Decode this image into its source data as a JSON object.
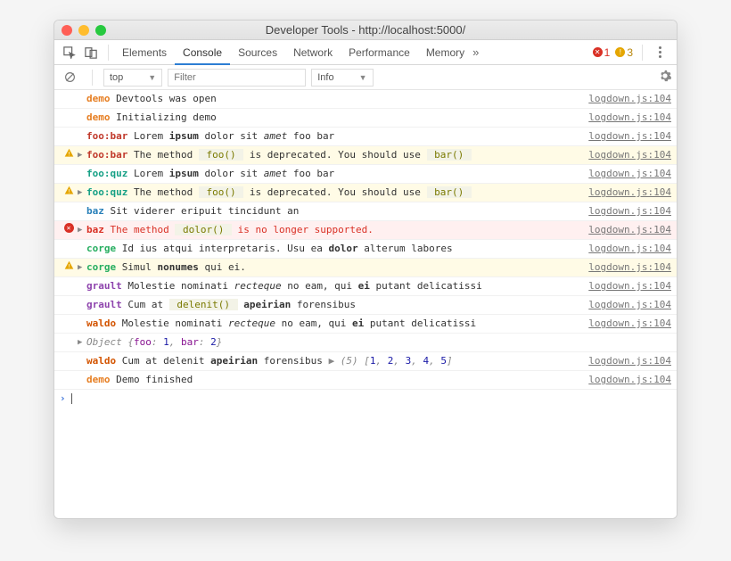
{
  "window_title": "Developer Tools - http://localhost:5000/",
  "tabs": [
    "Elements",
    "Console",
    "Sources",
    "Network",
    "Performance",
    "Memory"
  ],
  "active_tab": "Console",
  "error_count": "1",
  "warning_count": "3",
  "context_select": "top",
  "filter_placeholder": "Filter",
  "level_select": "Info",
  "overflow_glyph": "»",
  "source_link": "logdown.js:104",
  "logs": [
    {
      "level": "log",
      "tag": "demo",
      "tagcls": "tag-demo",
      "expand": false,
      "segs": [
        {
          "t": " Devtools was open"
        }
      ]
    },
    {
      "level": "log",
      "tag": "demo",
      "tagcls": "tag-demo",
      "expand": false,
      "segs": [
        {
          "t": " Initializing demo"
        }
      ]
    },
    {
      "level": "log",
      "tag": "foo:bar",
      "tagcls": "tag-foobar",
      "expand": false,
      "segs": [
        {
          "t": " Lorem "
        },
        {
          "t": "ipsum",
          "cls": "b"
        },
        {
          "t": " dolor sit "
        },
        {
          "t": "amet",
          "cls": "i"
        },
        {
          "t": " foo bar"
        }
      ]
    },
    {
      "level": "warning",
      "tag": "foo:bar",
      "tagcls": "tag-foobar",
      "expand": true,
      "segs": [
        {
          "t": " The method "
        },
        {
          "t": " foo() ",
          "cls": "code"
        },
        {
          "t": " is deprecated. You should use "
        },
        {
          "t": " bar() ",
          "cls": "code"
        }
      ]
    },
    {
      "level": "log",
      "tag": "foo:quz",
      "tagcls": "tag-fooquz",
      "expand": false,
      "segs": [
        {
          "t": " Lorem "
        },
        {
          "t": "ipsum",
          "cls": "b"
        },
        {
          "t": " dolor sit "
        },
        {
          "t": "amet",
          "cls": "i"
        },
        {
          "t": " foo bar"
        }
      ]
    },
    {
      "level": "warning",
      "tag": "foo:quz",
      "tagcls": "tag-fooquz",
      "expand": true,
      "segs": [
        {
          "t": " The method "
        },
        {
          "t": " foo() ",
          "cls": "code"
        },
        {
          "t": " is deprecated. You should use "
        },
        {
          "t": " bar() ",
          "cls": "code"
        }
      ]
    },
    {
      "level": "log",
      "tag": "baz",
      "tagcls": "tag-baz",
      "expand": false,
      "segs": [
        {
          "t": " Sit viderer eripuit tincidunt an"
        }
      ]
    },
    {
      "level": "error",
      "tag": "baz",
      "tagcls": "tag-baz",
      "expand": true,
      "segs": [
        {
          "t": " The method "
        },
        {
          "t": " dolor() ",
          "cls": "code"
        },
        {
          "t": " is no longer supported."
        }
      ]
    },
    {
      "level": "log",
      "tag": "corge",
      "tagcls": "tag-corge",
      "expand": false,
      "segs": [
        {
          "t": " Id ius atqui interpretaris. Usu ea "
        },
        {
          "t": "dolor",
          "cls": "b"
        },
        {
          "t": " alterum labores"
        }
      ]
    },
    {
      "level": "warning",
      "tag": "corge",
      "tagcls": "tag-corge",
      "expand": true,
      "segs": [
        {
          "t": " Simul "
        },
        {
          "t": "nonumes",
          "cls": "b"
        },
        {
          "t": " qui ei."
        }
      ]
    },
    {
      "level": "log",
      "tag": "grault",
      "tagcls": "tag-grault",
      "expand": false,
      "segs": [
        {
          "t": " Molestie nominati "
        },
        {
          "t": "recteque",
          "cls": "i"
        },
        {
          "t": " no eam, qui "
        },
        {
          "t": "ei",
          "cls": "b"
        },
        {
          "t": " putant delicatissi"
        }
      ]
    },
    {
      "level": "log",
      "tag": "grault",
      "tagcls": "tag-grault",
      "expand": false,
      "segs": [
        {
          "t": " Cum at "
        },
        {
          "t": " delenit() ",
          "cls": "code"
        },
        {
          "t": " "
        },
        {
          "t": "apeirian",
          "cls": "b"
        },
        {
          "t": " forensibus"
        }
      ]
    },
    {
      "level": "log",
      "tag": "waldo",
      "tagcls": "tag-waldo",
      "expand": false,
      "segs": [
        {
          "t": " Molestie nominati "
        },
        {
          "t": "recteque",
          "cls": "i"
        },
        {
          "t": " no eam, qui "
        },
        {
          "t": "ei",
          "cls": "b"
        },
        {
          "t": " putant delicatissi"
        }
      ],
      "obj": {
        "type": "object",
        "preview": [
          {
            "k": "foo",
            "v": "1"
          },
          {
            "k": "bar",
            "v": "2"
          }
        ]
      }
    },
    {
      "level": "log",
      "tag": "waldo",
      "tagcls": "tag-waldo",
      "expand": false,
      "segs": [
        {
          "t": " Cum at delenit "
        },
        {
          "t": "apeirian",
          "cls": "b"
        },
        {
          "t": " forensibus "
        }
      ],
      "arr": {
        "len": "5",
        "items": [
          "1",
          "2",
          "3",
          "4",
          "5"
        ]
      }
    },
    {
      "level": "log",
      "tag": "demo",
      "tagcls": "tag-demo",
      "expand": false,
      "segs": [
        {
          "t": " Demo finished"
        }
      ]
    }
  ]
}
